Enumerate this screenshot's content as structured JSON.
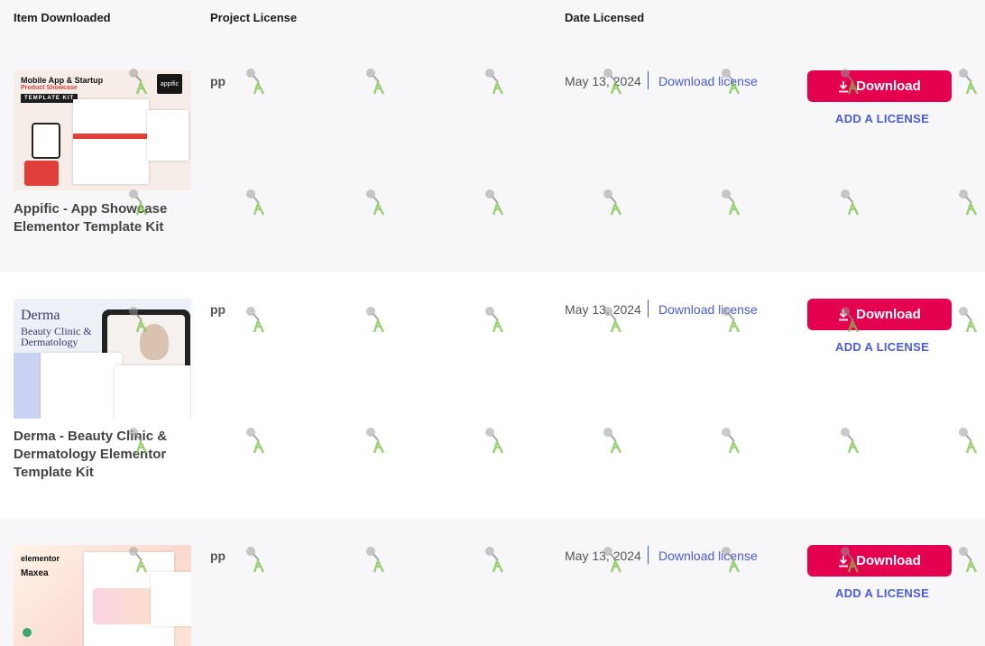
{
  "table": {
    "headers": {
      "item": "Item Downloaded",
      "project": "Project License",
      "date": "Date Licensed"
    },
    "rows": [
      {
        "name": "Appific - App Showcase Elementor Template Kit",
        "project": "pp",
        "date": "May 13, 2024",
        "license_link": "Download license",
        "download_label": "Download",
        "add_license_label": "ADD A LICENSE",
        "thumb": {
          "title": "Mobile App & Startup",
          "subtitle": "Product Showcase",
          "tag": "TEMPLATE KIT",
          "logo": "appific"
        }
      },
      {
        "name": "Derma - Beauty Clinic & Dermatology Elementor Template Kit",
        "project": "pp",
        "date": "May 13, 2024",
        "license_link": "Download license",
        "download_label": "Download",
        "add_license_label": "ADD A LICENSE",
        "thumb": {
          "brand": "Derma",
          "subtitle": "Beauty Clinic & Dermatology"
        }
      },
      {
        "name": "",
        "project": "pp",
        "date": "May 13, 2024",
        "license_link": "Download license",
        "download_label": "Download",
        "add_license_label": "ADD A LICENSE",
        "thumb": {
          "brand": "elementor",
          "name": "Maxea"
        }
      }
    ]
  },
  "colors": {
    "accent": "#e4004f",
    "link": "#4b5bd6"
  }
}
